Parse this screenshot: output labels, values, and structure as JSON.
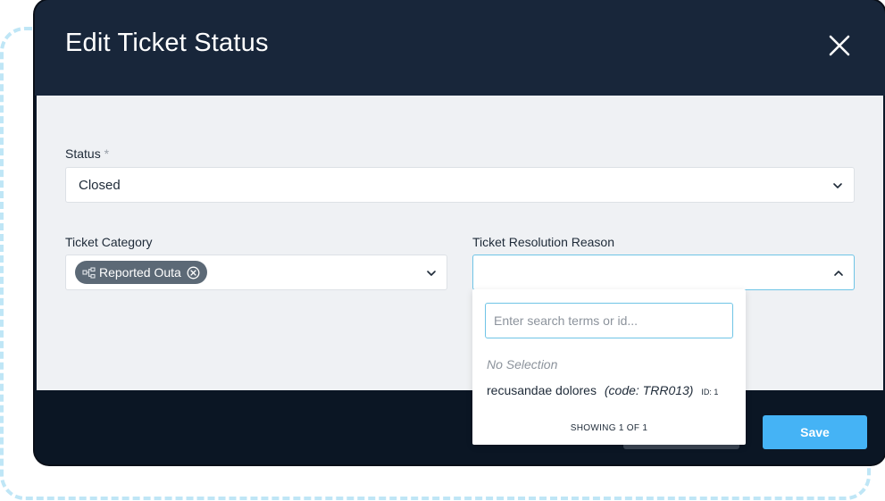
{
  "modal": {
    "title": "Edit Ticket Status"
  },
  "status_field": {
    "label": "Status",
    "required_mark": "*",
    "value": "Closed"
  },
  "category_field": {
    "label": "Ticket Category",
    "chip_label": "Reported Outa"
  },
  "resolution_field": {
    "label": "Ticket Resolution Reason",
    "value": ""
  },
  "dropdown": {
    "search_placeholder": "Enter search terms or id...",
    "no_selection": "No Selection",
    "options": [
      {
        "name": "recusandae dolores",
        "code": "(code: TRR013)",
        "id": "ID: 1"
      }
    ],
    "showing": "SHOWING 1 OF 1"
  },
  "footer": {
    "save_label": "Save"
  },
  "colors": {
    "header": "#18263a",
    "body": "#eff1f4",
    "accent": "#45b3f5",
    "chip": "#5c6976"
  }
}
